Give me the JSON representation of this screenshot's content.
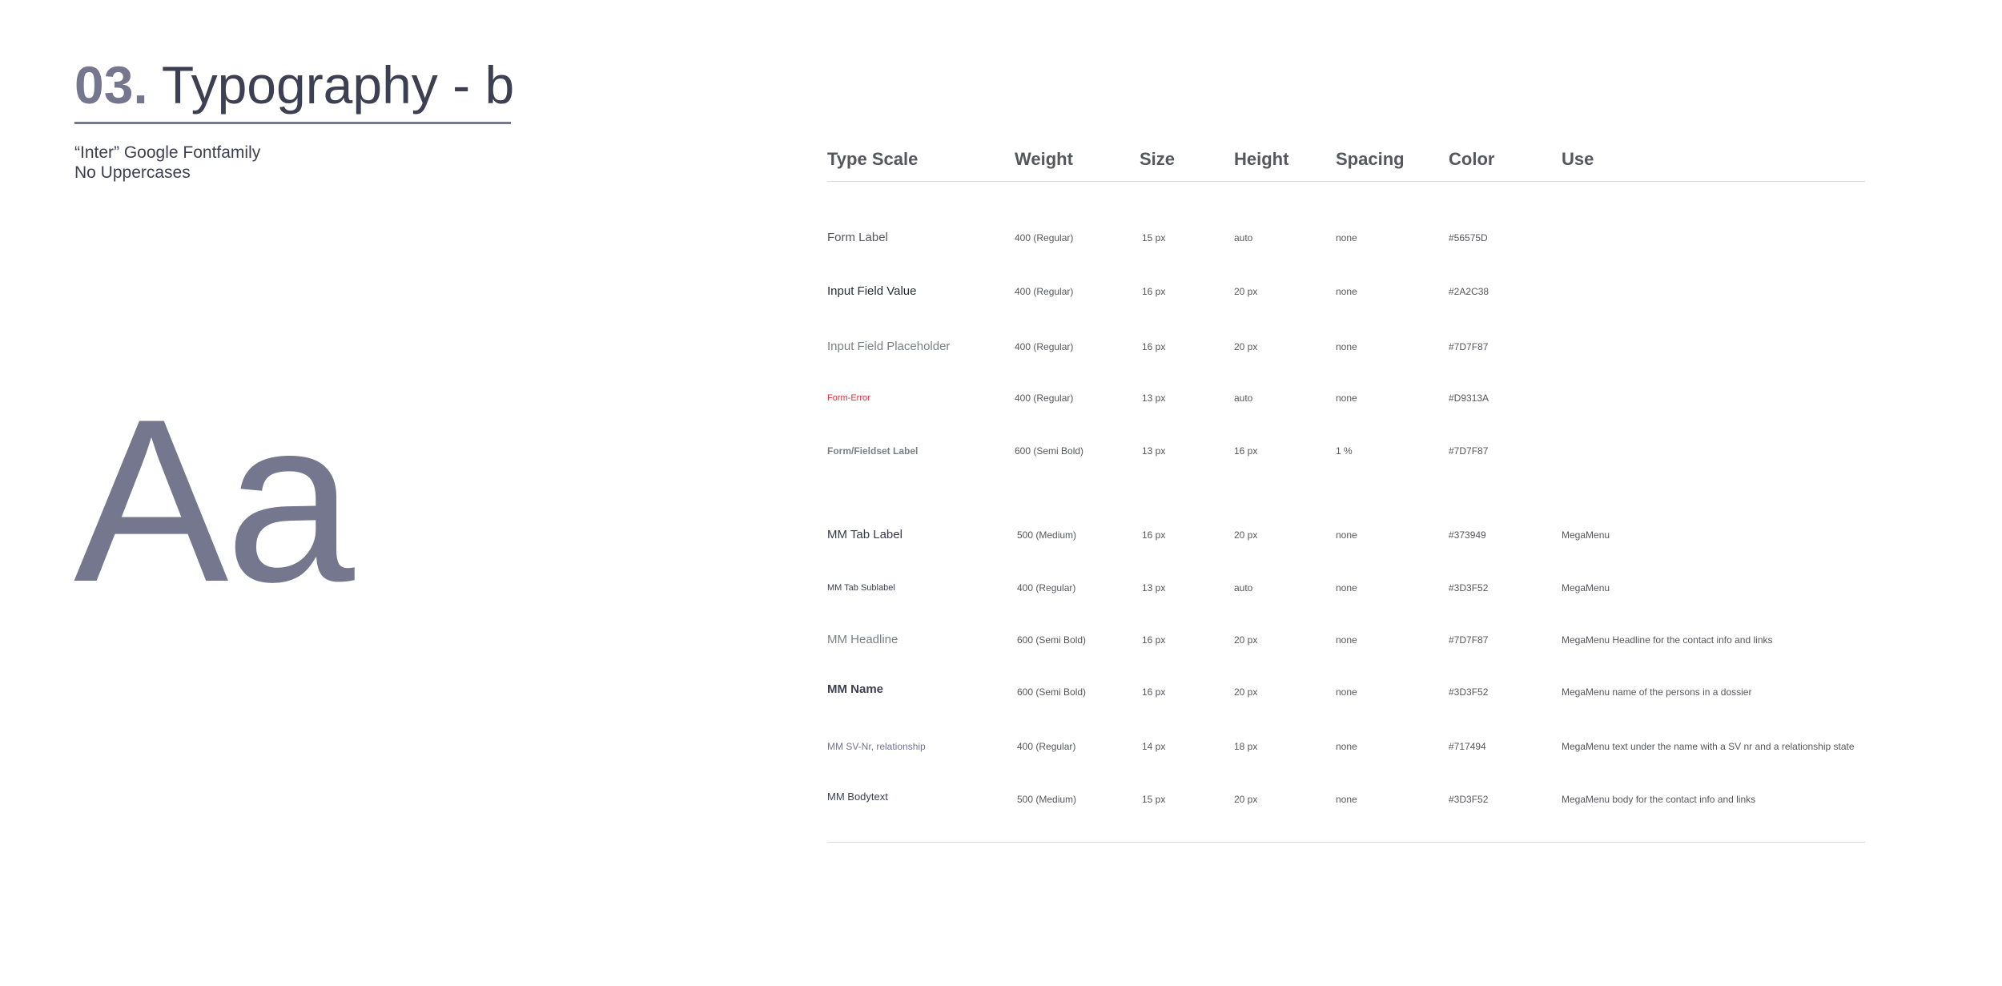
{
  "header": {
    "title_number": "03.",
    "title_text": "Typography - b",
    "subtitle_line1": "“Inter” Google Fontfamily",
    "subtitle_line2": "No Uppercases"
  },
  "specimen": {
    "text": "Aa",
    "color": "#75778F"
  },
  "table": {
    "columns": [
      "Type Scale",
      "Weight",
      "Size",
      "Height",
      "Spacing",
      "Color",
      "Use"
    ],
    "rows": [
      {
        "scale": "Form Label",
        "weight": "400 (Regular)",
        "size": "15 px",
        "height": "auto",
        "spacing": "none",
        "color": "#56575D",
        "use": ""
      },
      {
        "scale": "Input Field Value",
        "weight": "400 (Regular)",
        "size": "16 px",
        "height": "20 px",
        "spacing": "none",
        "color": "#2A2C38",
        "use": ""
      },
      {
        "scale": "Input Field Placeholder",
        "weight": "400 (Regular)",
        "size": "16 px",
        "height": "20 px",
        "spacing": "none",
        "color": "#7D7F87",
        "use": ""
      },
      {
        "scale": "Form-Error",
        "weight": "400 (Regular)",
        "size": "13 px",
        "height": "auto",
        "spacing": "none",
        "color": "#D9313A",
        "use": ""
      },
      {
        "scale": "Form/Fieldset Label",
        "weight": "600 (Semi Bold)",
        "size": "13 px",
        "height": "16 px",
        "spacing": "1 %",
        "color": "#7D7F87",
        "use": ""
      },
      {
        "scale": "MM Tab Label",
        "weight": "500 (Medium)",
        "size": "16 px",
        "height": "20 px",
        "spacing": "none",
        "color": "#373949",
        "use": "MegaMenu"
      },
      {
        "scale": "MM Tab Sublabel",
        "weight": "400 (Regular)",
        "size": "13 px",
        "height": "auto",
        "spacing": "none",
        "color": "#3D3F52",
        "use": "MegaMenu"
      },
      {
        "scale": "MM Headline",
        "weight": "600 (Semi Bold)",
        "size": "16 px",
        "height": "20 px",
        "spacing": "none",
        "color": "#7D7F87",
        "use": "MegaMenu Headline for the contact info and links"
      },
      {
        "scale": "MM Name",
        "weight": "600 (Semi Bold)",
        "size": "16 px",
        "height": "20 px",
        "spacing": "none",
        "color": "#3D3F52",
        "use": "MegaMenu name of the persons in a dossier"
      },
      {
        "scale": "MM SV-Nr, relationship",
        "weight": "400 (Regular)",
        "size": "14 px",
        "height": "18 px",
        "spacing": "none",
        "color": "#717494",
        "use": "MegaMenu text under the name with a SV nr and a relationship state"
      },
      {
        "scale": "MM Bodytext",
        "weight": "500 (Medium)",
        "size": "15 px",
        "height": "20 px",
        "spacing": "none",
        "color": "#3D3F52",
        "use": "MegaMenu body for the contact info and links"
      }
    ]
  }
}
